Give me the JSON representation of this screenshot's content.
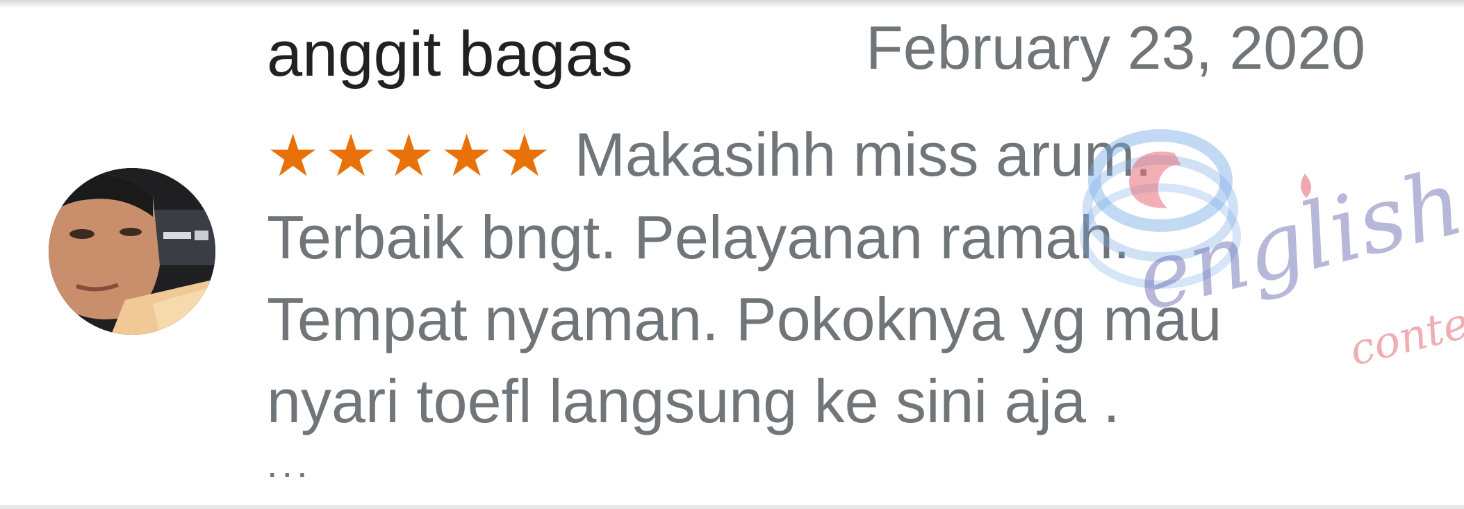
{
  "review": {
    "reviewer_name": "anggit bagas",
    "date": "February 23, 2020",
    "rating": 5,
    "star_glyph": "★",
    "text_lines": [
      "Makasihh miss arum.",
      "Terbaik bngt. Pelayanan ramah.",
      "Tempat nyaman. Pokoknya yg mau",
      "nyari toefl langsung ke sini aja ."
    ],
    "more_indicator": "..."
  },
  "watermark": {
    "main": "english",
    "sub": "conte"
  },
  "colors": {
    "star": "#e8710a",
    "name": "#202124",
    "secondary_text": "#70757a",
    "background": "#ffffff"
  },
  "icons": {
    "avatar": "reviewer-avatar-photo",
    "watermark_logo": "english-center-logo"
  }
}
